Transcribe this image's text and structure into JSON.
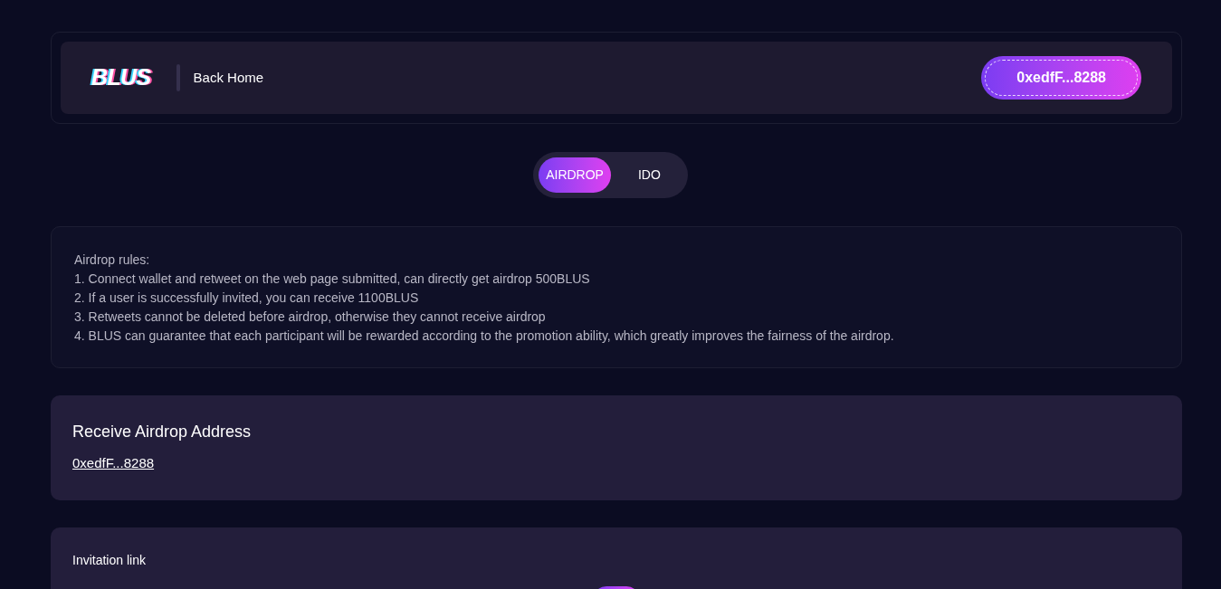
{
  "header": {
    "logo": "BLUS",
    "back_link": "Back Home",
    "wallet_button": "0xedfF...8288"
  },
  "tabs": [
    {
      "label": "AIRDROP",
      "selected": true
    },
    {
      "label": "IDO",
      "selected": false
    }
  ],
  "rules": {
    "title": "Airdrop rules:",
    "items": [
      "1. Connect wallet and retweet on the web page submitted, can directly get airdrop 500BLUS",
      "2. If a user is successfully invited, you can receive 1100BLUS",
      "3. Retweets cannot be deleted before airdrop, otherwise they cannot receive airdrop",
      "4. BLUS can guarantee that each participant will be rewarded according to the promotion ability, which greatly improves the fairness of the airdrop."
    ]
  },
  "address_card": {
    "title": "Receive Airdrop Address",
    "address": "0xedfF...8288"
  },
  "invitation_card": {
    "title": "Invitation link"
  }
}
